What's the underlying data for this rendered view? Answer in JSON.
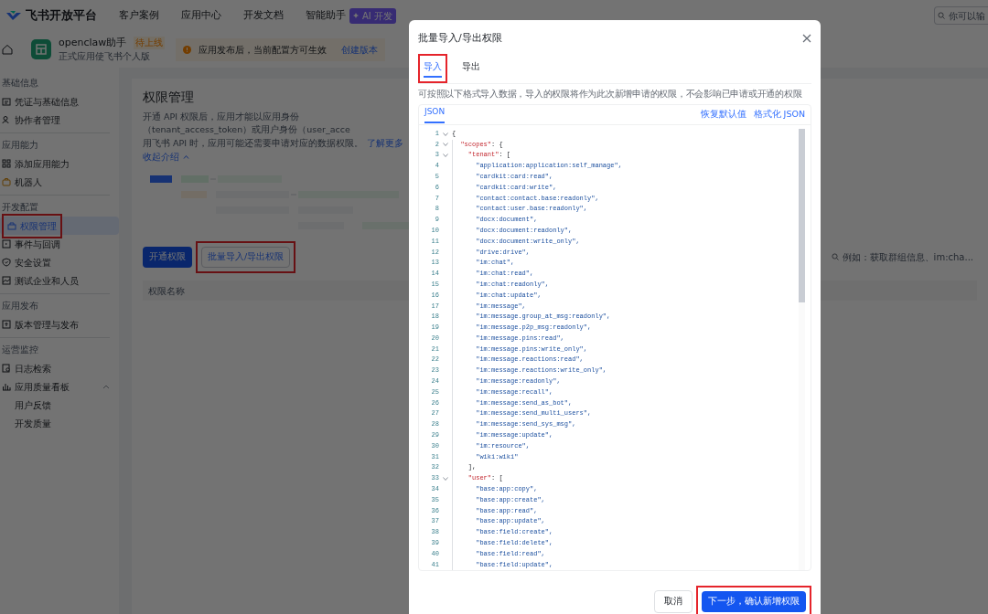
{
  "header": {
    "logo": "飞书开放平台",
    "nav": [
      {
        "label": "客户案例"
      },
      {
        "label": "应用中心"
      },
      {
        "label": "开发文档"
      },
      {
        "label": "智能助手",
        "badge": "AI 开发"
      }
    ],
    "search": {
      "placeholder": "你可以输"
    }
  },
  "app": {
    "name": "openclaw助手",
    "status": "待上线",
    "subtitle": "正式应用使飞书个人版",
    "notice": "应用发布后，当前配置方可生效",
    "notice_link": "创建版本"
  },
  "sidebar": {
    "sections": [
      {
        "title": "基础信息",
        "items": [
          {
            "label": "凭证与基础信息",
            "selected": false,
            "highlighted": false
          },
          {
            "label": "协作者管理",
            "selected": false,
            "highlighted": false
          }
        ]
      },
      {
        "title": "应用能力",
        "items": [
          {
            "label": "添加应用能力",
            "selected": false,
            "highlighted": false
          },
          {
            "label": "机器人",
            "selected": false,
            "highlighted": false
          }
        ]
      },
      {
        "title": "开发配置",
        "items": [
          {
            "label": "权限管理",
            "selected": true,
            "highlighted": true
          },
          {
            "label": "事件与回调",
            "selected": false,
            "highlighted": false
          },
          {
            "label": "安全设置",
            "selected": false,
            "highlighted": false
          },
          {
            "label": "测试企业和人员",
            "selected": false,
            "highlighted": false
          }
        ]
      },
      {
        "title": "应用发布",
        "items": [
          {
            "label": "版本管理与发布",
            "selected": false,
            "highlighted": false
          }
        ]
      },
      {
        "title": "运营监控",
        "items": [
          {
            "label": "日志检索",
            "selected": false,
            "highlighted": false
          },
          {
            "label": "应用质量看板",
            "selected": false,
            "highlighted": false,
            "expanded": true,
            "children": [
              {
                "label": "用户反馈",
                "selected": false
              },
              {
                "label": "开发质量",
                "selected": false
              }
            ]
          }
        ]
      }
    ]
  },
  "main": {
    "title": "权限管理",
    "description_lines": [
      "开通 API 权限后，应用才能以应用身份（tenant_access_token）或用户身份（user_acce",
      "用飞书 API 时，应用可能还需要申请对应的数据权限。"
    ],
    "learn_more": "了解更多",
    "collapse": "收起介绍",
    "buttons": [
      {
        "label": "开通权限",
        "kind": "primary",
        "highlighted": false
      },
      {
        "label": "批量导入/导出权限",
        "kind": "outline",
        "highlighted": true
      }
    ],
    "search": {
      "placeholder": "例如：获取群组信息、im:cha..."
    },
    "table": {
      "columns": [
        "权限名称"
      ]
    }
  },
  "dialog": {
    "title": "批量导入/导出权限",
    "tabs": [
      {
        "label": "导入",
        "selected": true,
        "highlighted": true
      },
      {
        "label": "导出",
        "selected": false,
        "highlighted": false
      }
    ],
    "description": "可按照以下格式导入数据，导入的权限将作为此次新增申请的权限，不会影响已申请或开通的权限",
    "editor": {
      "tabs": [
        {
          "label": "JSON",
          "selected": true
        }
      ],
      "actions": [
        "恢复默认值",
        "格式化 JSON"
      ],
      "lines": [
        {
          "number": "1",
          "kind": "punct",
          "text": "{",
          "fold": true
        },
        {
          "number": "2",
          "kind": "key",
          "key": "  \"scopes\"",
          "text": ": {",
          "fold": true
        },
        {
          "number": "3",
          "kind": "key",
          "key": "    \"tenant\"",
          "text": ": [",
          "fold": true
        },
        {
          "number": "4",
          "kind": "string",
          "text": "      \"application:application:self_manage\","
        },
        {
          "number": "5",
          "kind": "string",
          "text": "      \"cardkit:card:read\","
        },
        {
          "number": "6",
          "kind": "string",
          "text": "      \"cardkit:card:write\","
        },
        {
          "number": "7",
          "kind": "string",
          "text": "      \"contact:contact.base:readonly\","
        },
        {
          "number": "8",
          "kind": "string",
          "text": "      \"contact:user.base:readonly\","
        },
        {
          "number": "9",
          "kind": "string",
          "text": "      \"docx:document\","
        },
        {
          "number": "10",
          "kind": "string",
          "text": "      \"docx:document:readonly\","
        },
        {
          "number": "11",
          "kind": "string",
          "text": "      \"docx:document:write_only\","
        },
        {
          "number": "12",
          "kind": "string",
          "text": "      \"drive:drive\","
        },
        {
          "number": "13",
          "kind": "string",
          "text": "      \"im:chat\","
        },
        {
          "number": "14",
          "kind": "string",
          "text": "      \"im:chat:read\","
        },
        {
          "number": "15",
          "kind": "string",
          "text": "      \"im:chat:readonly\","
        },
        {
          "number": "16",
          "kind": "string",
          "text": "      \"im:chat:update\","
        },
        {
          "number": "17",
          "kind": "string",
          "text": "      \"im:message\","
        },
        {
          "number": "18",
          "kind": "string",
          "text": "      \"im:message.group_at_msg:readonly\","
        },
        {
          "number": "19",
          "kind": "string",
          "text": "      \"im:message.p2p_msg:readonly\","
        },
        {
          "number": "20",
          "kind": "string",
          "text": "      \"im:message.pins:read\","
        },
        {
          "number": "21",
          "kind": "string",
          "text": "      \"im:message.pins:write_only\","
        },
        {
          "number": "22",
          "kind": "string",
          "text": "      \"im:message.reactions:read\","
        },
        {
          "number": "23",
          "kind": "string",
          "text": "      \"im:message.reactions:write_only\","
        },
        {
          "number": "24",
          "kind": "string",
          "text": "      \"im:message:readonly\","
        },
        {
          "number": "25",
          "kind": "string",
          "text": "      \"im:message:recall\","
        },
        {
          "number": "26",
          "kind": "string",
          "text": "      \"im:message:send_as_bot\","
        },
        {
          "number": "27",
          "kind": "string",
          "text": "      \"im:message:send_multi_users\","
        },
        {
          "number": "28",
          "kind": "string",
          "text": "      \"im:message:send_sys_msg\","
        },
        {
          "number": "29",
          "kind": "string",
          "text": "      \"im:message:update\","
        },
        {
          "number": "30",
          "kind": "string",
          "text": "      \"im:resource\","
        },
        {
          "number": "31",
          "kind": "string",
          "text": "      \"wiki:wiki\""
        },
        {
          "number": "32",
          "kind": "punct",
          "text": "    ],"
        },
        {
          "number": "33",
          "kind": "key",
          "key": "    \"user\"",
          "text": ": [",
          "fold": true
        },
        {
          "number": "34",
          "kind": "string",
          "text": "      \"base:app:copy\","
        },
        {
          "number": "35",
          "kind": "string",
          "text": "      \"base:app:create\","
        },
        {
          "number": "36",
          "kind": "string",
          "text": "      \"base:app:read\","
        },
        {
          "number": "37",
          "kind": "string",
          "text": "      \"base:app:update\","
        },
        {
          "number": "38",
          "kind": "string",
          "text": "      \"base:field:create\","
        },
        {
          "number": "39",
          "kind": "string",
          "text": "      \"base:field:delete\","
        },
        {
          "number": "40",
          "kind": "string",
          "text": "      \"base:field:read\","
        },
        {
          "number": "41",
          "kind": "string",
          "text": "      \"base:field:update\","
        }
      ]
    },
    "buttons": [
      {
        "label": "取消",
        "kind": "secondary",
        "highlighted": false
      },
      {
        "label": "下一步，确认新增权限",
        "kind": "primary",
        "highlighted": true
      }
    ]
  }
}
